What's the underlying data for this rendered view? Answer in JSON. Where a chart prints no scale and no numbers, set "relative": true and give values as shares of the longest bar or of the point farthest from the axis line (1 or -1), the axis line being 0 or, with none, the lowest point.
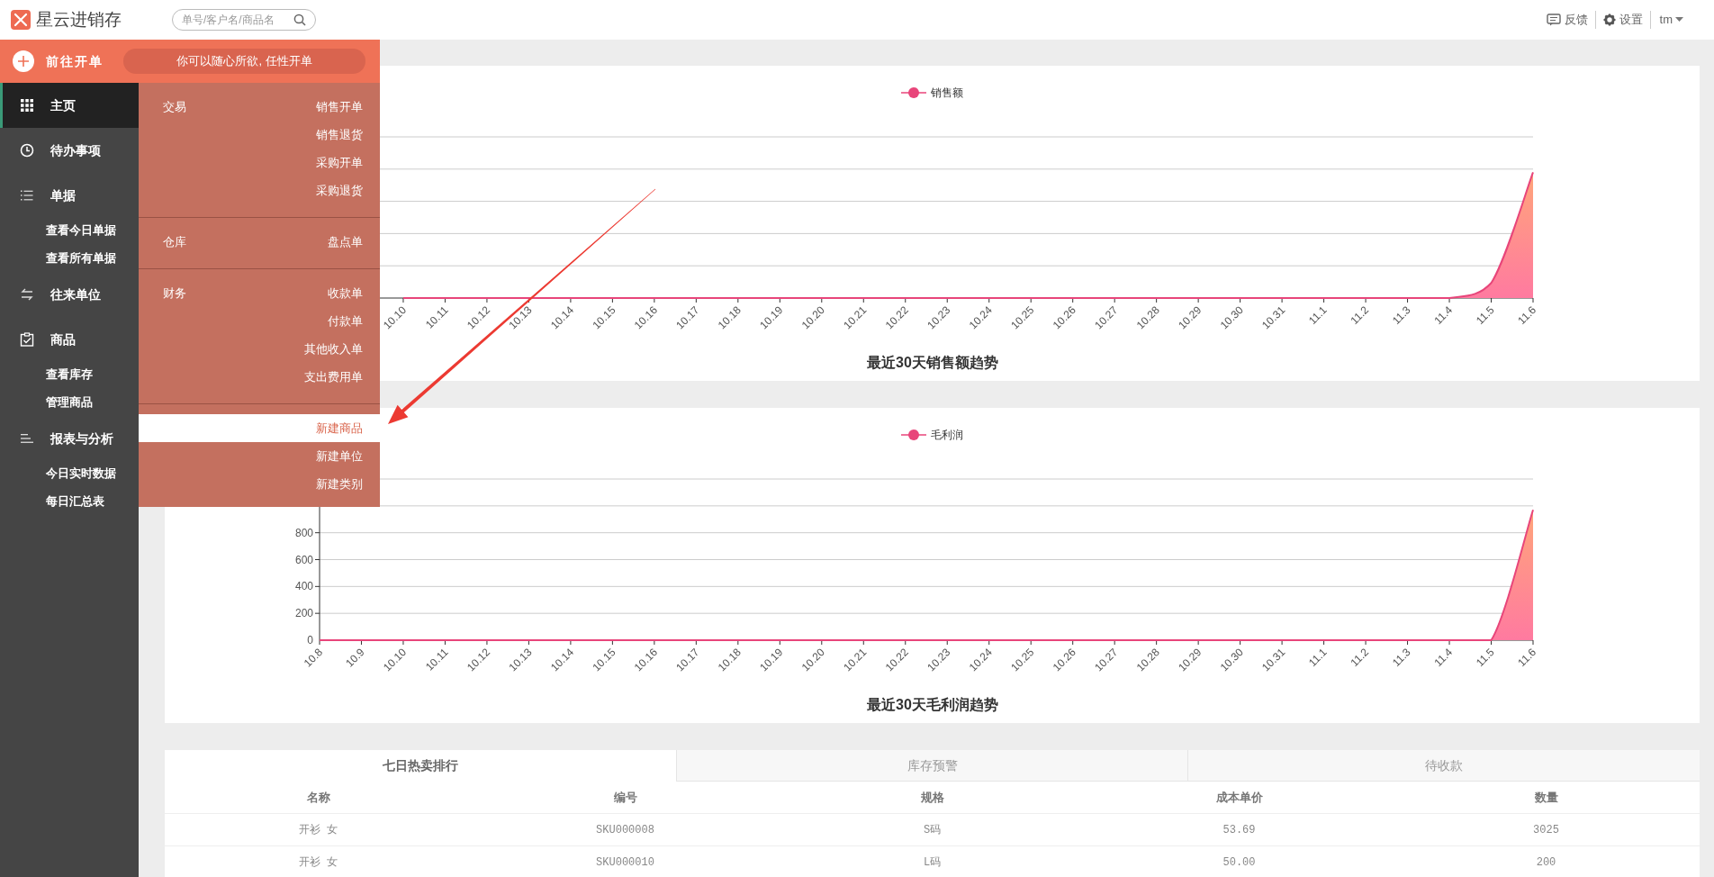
{
  "header": {
    "app_name": "星云进销存",
    "search": {
      "placeholder": "单号/客户名/商品名"
    },
    "links": [
      {
        "kind": "feedback",
        "label": "反馈"
      },
      {
        "kind": "settings",
        "label": "设置"
      }
    ],
    "user": "tm"
  },
  "quick_open": {
    "label": "前往开单",
    "slogan": "你可以随心所欲, 任性开单"
  },
  "sidebar": {
    "items": [
      {
        "label": "主页",
        "selected": true
      },
      {
        "label": "待办事项",
        "selected": false
      },
      {
        "label": "单据",
        "selected": false,
        "children": [
          {
            "label": "查看今日单据",
            "selected": false
          },
          {
            "label": "查看所有单据",
            "selected": false
          }
        ]
      },
      {
        "label": "往来单位",
        "selected": false
      },
      {
        "label": "商品",
        "selected": false,
        "children": [
          {
            "label": "查看库存",
            "selected": false
          },
          {
            "label": "管理商品",
            "selected": false
          }
        ]
      },
      {
        "label": "报表与分析",
        "selected": false,
        "children": [
          {
            "label": "今日实时数据",
            "selected": false
          },
          {
            "label": "每日汇总表",
            "selected": false
          }
        ]
      }
    ]
  },
  "quick_menu": {
    "groups": [
      {
        "label": "交易",
        "items": [
          {
            "label": "销售开单",
            "selected": false
          },
          {
            "label": "销售退货",
            "selected": false
          },
          {
            "label": "采购开单",
            "selected": false
          },
          {
            "label": "采购退货",
            "selected": false
          }
        ]
      },
      {
        "label": "仓库",
        "items": [
          {
            "label": "盘点单",
            "selected": false
          }
        ]
      },
      {
        "label": "财务",
        "items": [
          {
            "label": "收款单",
            "selected": false
          },
          {
            "label": "付款单",
            "selected": false
          },
          {
            "label": "其他收入单",
            "selected": false
          },
          {
            "label": "支出费用单",
            "selected": false
          }
        ]
      },
      {
        "items": [
          {
            "label": "新建商品",
            "selected": true
          },
          {
            "label": "新建单位",
            "selected": false
          },
          {
            "label": "新建类别",
            "selected": false
          }
        ]
      }
    ]
  },
  "charts": [
    {
      "chart_data": {
        "type": "area",
        "title": "最近30天销售额趋势",
        "categories": [
          "10.10",
          "10.11",
          "10.12",
          "10.13",
          "10.14",
          "10.15",
          "10.16",
          "10.17",
          "10.18",
          "10.19",
          "10.20",
          "10.21",
          "10.22",
          "10.23",
          "10.24",
          "10.25",
          "10.26",
          "10.27",
          "10.28",
          "10.29",
          "10.30",
          "10.31",
          "11.1",
          "11.2",
          "11.3",
          "11.4",
          "11.5",
          "11.6"
        ],
        "series": [
          {
            "name": "销售额",
            "color": "#e8457a",
            "values": [
              0,
              0,
              0,
              0,
              0,
              0,
              0,
              0,
              0,
              0,
              0,
              0,
              0,
              0,
              0,
              0,
              0,
              0,
              0,
              0,
              0,
              0,
              0,
              0,
              0,
              0,
              0.12,
              1
            ]
          }
        ],
        "relative": true,
        "grid": true
      }
    },
    {
      "chart_data": {
        "type": "area",
        "title": "最近30天毛利润趋势",
        "categories": [
          "10.8",
          "10.9",
          "10.10",
          "10.11",
          "10.12",
          "10.13",
          "10.14",
          "10.15",
          "10.16",
          "10.17",
          "10.18",
          "10.19",
          "10.20",
          "10.21",
          "10.22",
          "10.23",
          "10.24",
          "10.25",
          "10.26",
          "10.27",
          "10.28",
          "10.29",
          "10.30",
          "10.31",
          "11.1",
          "11.2",
          "11.3",
          "11.4",
          "11.5",
          "11.6"
        ],
        "series": [
          {
            "name": "毛利润",
            "color": "#e8457a",
            "values": [
              0,
              0,
              0,
              0,
              0,
              0,
              0,
              0,
              0,
              0,
              0,
              0,
              0,
              0,
              0,
              0,
              0,
              0,
              0,
              0,
              0,
              0,
              0,
              0,
              0,
              0,
              0,
              0,
              0,
              970
            ]
          }
        ],
        "ylim": [
          0,
          1200
        ],
        "yticks": [
          0,
          200,
          400,
          600,
          800
        ],
        "grid": true
      }
    }
  ],
  "table": {
    "tabs": [
      {
        "label": "七日热卖排行",
        "selected": true
      },
      {
        "label": "库存预警",
        "selected": false
      },
      {
        "label": "待收款",
        "selected": false
      }
    ],
    "columns": [
      "名称",
      "编号",
      "规格",
      "成本单价",
      "数量"
    ],
    "rows": [
      [
        "开衫 女",
        "SKU000008",
        "S码",
        "53.69",
        "3025"
      ],
      [
        "开衫 女",
        "SKU000010",
        "L码",
        "50.00",
        "200"
      ]
    ]
  }
}
